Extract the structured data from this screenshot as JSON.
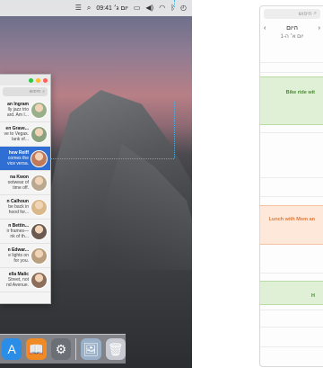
{
  "menubar": {
    "clock": "09:41 יום ג׳",
    "icons": [
      "search-icon",
      "volume-icon",
      "battery-icon",
      "wifi-icon",
      "bluetooth-icon",
      "time-machine-icon",
      "list-icon"
    ]
  },
  "messages": {
    "search_placeholder": "חיפוש",
    "conversations": [
      {
        "name": "an Ingram",
        "line1": "lly jazz trio",
        "line2": "ard. Am I...",
        "avatar": "#9ab08a",
        "selected": false
      },
      {
        "name": "en Grave...",
        "line1": "ve to Vegas.",
        "line2": "lank of...",
        "avatar": "#8aa27e",
        "selected": false
      },
      {
        "name": "hew Reiff",
        "line1": "comes the",
        "line2": "vice versa.",
        "avatar": "#c07a5b",
        "selected": true
      },
      {
        "name": "na Kwon",
        "line1": "ootwear of",
        "line2": "time off.",
        "avatar": "#b9a78f",
        "selected": false
      },
      {
        "name": "n Calhoun",
        "line1": "be back in",
        "line2": "hood for...",
        "avatar": "#d9b98a",
        "selected": false
      },
      {
        "name": "n Bettin...",
        "line1": "ir frames—",
        "line2": "nk of th...",
        "avatar": "#6b5a4f",
        "selected": false
      },
      {
        "name": "n Edwar...",
        "line1": "e lights on",
        "line2": "for you.",
        "avatar": "#b99f7e",
        "selected": false
      },
      {
        "name": "ella Malic",
        "line1": "Street, not",
        "line2": "nd Avenue.",
        "avatar": "#8c6e5a",
        "selected": false
      }
    ]
  },
  "dock": {
    "items": [
      {
        "name": "app-store-icon",
        "glyph": "A",
        "color": "#2a8de8"
      },
      {
        "name": "ibooks-icon",
        "glyph": "📖",
        "color": "#f08a24"
      },
      {
        "name": "system-preferences-icon",
        "glyph": "⚙",
        "color": "#6b6f76"
      },
      {
        "name": "preview-icon",
        "glyph": "🖼",
        "color": "#9ab0c8"
      },
      {
        "name": "trash-icon",
        "glyph": "🗑",
        "color": "#c8ccd2"
      }
    ]
  },
  "calendar": {
    "search_placeholder": "חיפוש",
    "today_label": "היום",
    "prev_symbol": "‹",
    "next_symbol": "›",
    "day_label": "יום א׳ ה-1",
    "events": [
      {
        "title": "Bike ride wit",
        "bg": "#dff0d6",
        "border": "#b8dba7",
        "color": "#4d8a34"
      },
      {
        "title": "Lunch with Mom an",
        "bg": "#fde8da",
        "border": "#f4c2a3",
        "color": "#e07a3a"
      },
      {
        "title": "H",
        "bg": "#dff0d6",
        "border": "#b8dba7",
        "color": "#4d8a34"
      }
    ]
  }
}
